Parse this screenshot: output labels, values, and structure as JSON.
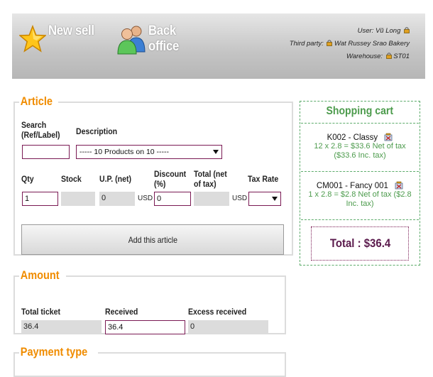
{
  "nav": {
    "new_sell": "New sell",
    "back_office_line1": "Back",
    "back_office_line2": "office"
  },
  "user_info": {
    "user_label": "User:",
    "user_name": "Vũ Long",
    "third_party_label": "Third party:",
    "third_party_value": "Wat Russey Srao Bakery",
    "warehouse_label": "Warehouse:",
    "warehouse_value": "ST01"
  },
  "article": {
    "legend": "Article",
    "search_label_1": "Search",
    "search_label_2": "(Ref/Label)",
    "search_value": "",
    "description_label": "Description",
    "description_selected": "----- 10 Products on 10 -----",
    "qty_label": "Qty",
    "stock_label": "Stock",
    "up_label": "U.P. (net)",
    "discount_label_1": "Discount",
    "discount_label_2": "(%)",
    "total_label_1": "Total (net",
    "total_label_2": "of tax)",
    "tax_label": "Tax Rate",
    "qty_value": "1",
    "stock_value": "",
    "up_value": "0",
    "currency": "USD",
    "discount_value": "0",
    "total_value": "",
    "tax_value": "",
    "add_button": "Add this article"
  },
  "cart": {
    "title": "Shopping cart",
    "items": [
      {
        "name": "K002 - Classy",
        "details": "12 x 2.8 = $33.6 Net of tax ($33.6 Inc. tax)"
      },
      {
        "name": "CM001 - Fancy 001",
        "details": "1 x 2.8 = $2.8 Net of tax ($2.8 Inc. tax)"
      }
    ],
    "total": "Total : $36.4"
  },
  "amount": {
    "legend": "Amount",
    "total_ticket_label": "Total ticket",
    "received_label": "Received",
    "excess_label": "Excess received",
    "total_ticket_value": "36.4",
    "received_value": "36.4",
    "excess_value": "0"
  },
  "payment": {
    "legend": "Payment type"
  },
  "colors": {
    "accent_orange": "#f08c00",
    "cart_green": "#4c9b4c",
    "input_border": "#7a1a54"
  }
}
